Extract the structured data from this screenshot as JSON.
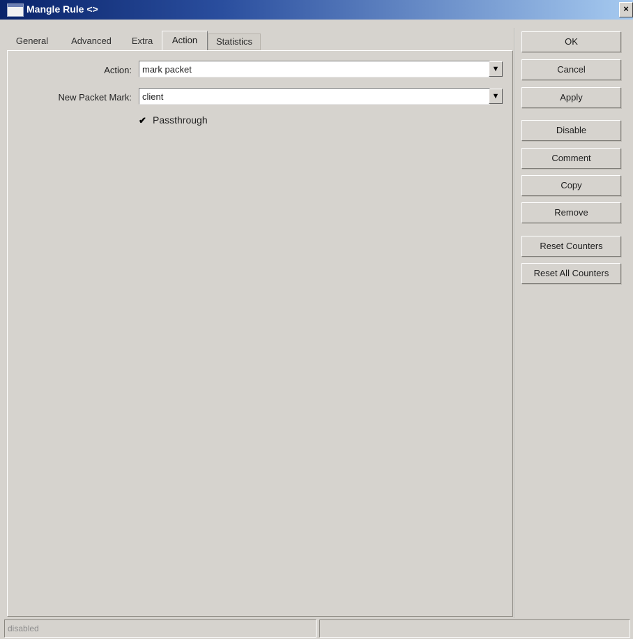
{
  "window": {
    "title": "Mangle Rule <>",
    "close_glyph": "×"
  },
  "tabs": [
    {
      "label": "General"
    },
    {
      "label": "Advanced"
    },
    {
      "label": "Extra"
    },
    {
      "label": "Action",
      "active": true
    },
    {
      "label": "Statistics"
    }
  ],
  "form": {
    "action_label": "Action:",
    "action_value": "mark packet",
    "packet_mark_label": "New Packet Mark:",
    "packet_mark_value": "client",
    "passthrough_label": "Passthrough",
    "passthrough_checked": true,
    "dropdown_glyph": "▼",
    "check_glyph": "✔"
  },
  "buttons": {
    "ok": "OK",
    "cancel": "Cancel",
    "apply": "Apply",
    "disable": "Disable",
    "comment": "Comment",
    "copy": "Copy",
    "remove": "Remove",
    "reset_counters": "Reset Counters",
    "reset_all_counters": "Reset All Counters"
  },
  "status": {
    "state": "disabled",
    "extra": ""
  },
  "colors": {
    "titlebar_start": "#0a246a",
    "titlebar_end": "#a6caf0",
    "face": "#d6d3ce"
  },
  "icons": {
    "window_icon": "window-icon",
    "close_icon": "close-icon",
    "dropdown_icon": "dropdown-arrow-icon",
    "check_icon": "checkmark-icon"
  }
}
